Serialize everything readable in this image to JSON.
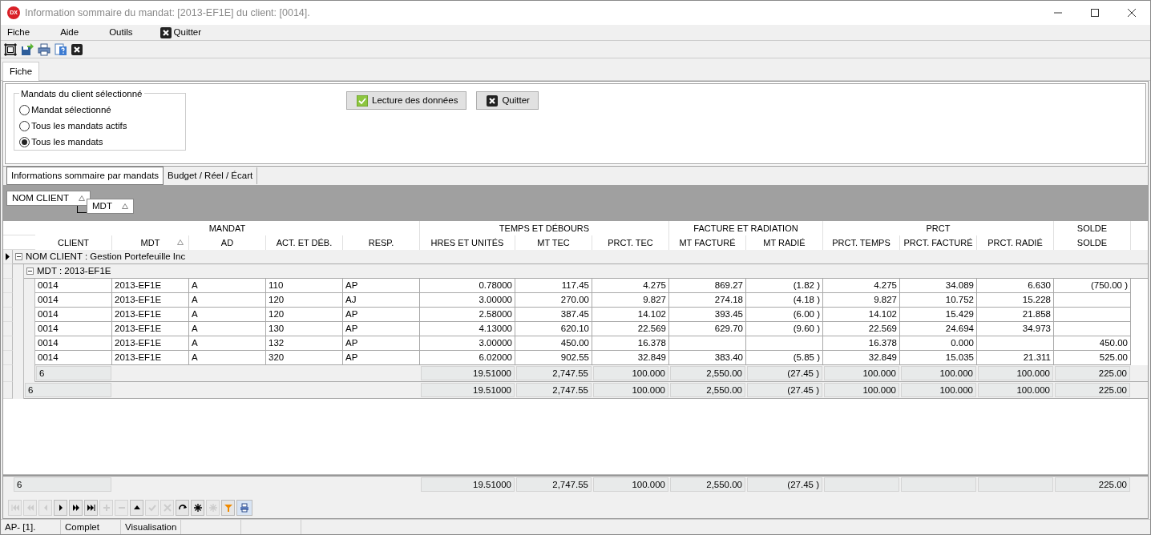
{
  "window": {
    "title": "Information sommaire du mandat: [2013-EF1E] du client: [0014].",
    "icon_text": "DX"
  },
  "menu": [
    {
      "label": "Fiche",
      "kind": "plain"
    },
    {
      "label": "Aide",
      "kind": "plain"
    },
    {
      "label": "Outils",
      "kind": "plain"
    },
    {
      "label": "Quitter",
      "kind": "close"
    }
  ],
  "toolbar": [
    {
      "kind": "frame"
    },
    {
      "kind": "save"
    },
    {
      "kind": "print"
    },
    {
      "kind": "help"
    },
    {
      "kind": "close"
    }
  ],
  "tabs": [
    {
      "label": "Fiche",
      "selected": true
    }
  ],
  "options": {
    "title": "Mandats du client sélectionné",
    "radios": [
      {
        "label": "Mandat sélectionné",
        "selected": false
      },
      {
        "label": "Tous les mandats actifs",
        "selected": false
      },
      {
        "label": "Tous les mandats",
        "selected": true
      }
    ]
  },
  "buttons": [
    {
      "label": "Lecture des données",
      "kind": "check"
    },
    {
      "label": "Quitter",
      "kind": "close"
    }
  ],
  "subtabs": [
    {
      "label": "Informations sommaire par mandats",
      "selected": true
    },
    {
      "label": "Budget / Réel / Écart",
      "selected": false
    }
  ],
  "group_by": [
    {
      "label": "NOM CLIENT"
    },
    {
      "label": "MDT"
    }
  ],
  "grid": {
    "bands": [
      {
        "label": "MANDAT",
        "columns": [
          {
            "label": "CLIENT",
            "sorted": false
          },
          {
            "label": "MDT",
            "sorted": true
          },
          {
            "label": "AD",
            "sorted": false
          },
          {
            "label": "ACT. ET DÉB.",
            "sorted": false
          },
          {
            "label": "RESP.",
            "sorted": false
          }
        ]
      },
      {
        "label": "TEMPS ET DÉBOURS",
        "columns": [
          {
            "label": "HRES ET UNITÉS",
            "sorted": false
          },
          {
            "label": "MT  TEC",
            "sorted": false
          },
          {
            "label": "PRCT.  TEC",
            "sorted": false
          }
        ]
      },
      {
        "label": "FACTURE ET RADIATION",
        "columns": [
          {
            "label": "MT FACTURÉ",
            "sorted": false
          },
          {
            "label": "MT RADIÉ",
            "sorted": false
          }
        ]
      },
      {
        "label": "PRCT",
        "columns": [
          {
            "label": "PRCT. TEMPS",
            "sorted": false
          },
          {
            "label": "PRCT.  FACTURÉ",
            "sorted": false
          },
          {
            "label": "PRCT. RADIÉ",
            "sorted": false
          }
        ]
      },
      {
        "label": "SOLDE",
        "columns": [
          {
            "label": "SOLDE",
            "sorted": false
          }
        ]
      }
    ],
    "group": {
      "label": "NOM CLIENT : Gestion Portefeuille Inc",
      "expanded": true,
      "current": true,
      "children": [
        {
          "label": "MDT : 2013-EF1E",
          "expanded": true,
          "current": false,
          "rows": [
            {
              "client": "0014",
              "mdt": "2013-EF1E",
              "ad": "A",
              "act": "110",
              "resp": "AP",
              "hres": "0.78000",
              "mt_tec": "117.45",
              "prct_tec": "4.275",
              "mt_facture": "869.27",
              "mt_radie": "(1.82 )",
              "prct_temps": "4.275",
              "prct_facture": "34.089",
              "prct_radie": "6.630",
              "solde": "(750.00 )"
            },
            {
              "client": "0014",
              "mdt": "2013-EF1E",
              "ad": "A",
              "act": "120",
              "resp": "AJ",
              "hres": "3.00000",
              "mt_tec": "270.00",
              "prct_tec": "9.827",
              "mt_facture": "274.18",
              "mt_radie": "(4.18 )",
              "prct_temps": "9.827",
              "prct_facture": "10.752",
              "prct_radie": "15.228"
            },
            {
              "client": "0014",
              "mdt": "2013-EF1E",
              "ad": "A",
              "act": "120",
              "resp": "AP",
              "hres": "2.58000",
              "mt_tec": "387.45",
              "prct_tec": "14.102",
              "mt_facture": "393.45",
              "mt_radie": "(6.00 )",
              "prct_temps": "14.102",
              "prct_facture": "15.429",
              "prct_radie": "21.858"
            },
            {
              "client": "0014",
              "mdt": "2013-EF1E",
              "ad": "A",
              "act": "130",
              "resp": "AP",
              "hres": "4.13000",
              "mt_tec": "620.10",
              "prct_tec": "22.569",
              "mt_facture": "629.70",
              "mt_radie": "(9.60 )",
              "prct_temps": "22.569",
              "prct_facture": "24.694",
              "prct_radie": "34.973"
            },
            {
              "client": "0014",
              "mdt": "2013-EF1E",
              "ad": "A",
              "act": "132",
              "resp": "AP",
              "hres": "3.00000",
              "mt_tec": "450.00",
              "prct_tec": "16.378",
              "prct_temps": "16.378",
              "prct_facture": "0.000",
              "solde": "450.00"
            },
            {
              "client": "0014",
              "mdt": "2013-EF1E",
              "ad": "A",
              "act": "320",
              "resp": "AP",
              "hres": "6.02000",
              "mt_tec": "902.55",
              "prct_tec": "32.849",
              "mt_facture": "383.40",
              "mt_radie": "(5.85 )",
              "prct_temps": "32.849",
              "prct_facture": "15.035",
              "prct_radie": "21.311",
              "solde": "525.00"
            }
          ],
          "footer": {
            "client": "6",
            "hres": "19.51000",
            "mt_tec": "2,747.55",
            "prct_tec": "100.000",
            "mt_facture": "2,550.00",
            "mt_radie": "(27.45 )",
            "prct_temps": "100.000",
            "prct_facture": "100.000",
            "prct_radie": "100.000",
            "solde": "225.00"
          }
        }
      ],
      "footer": {
        "client": "6",
        "hres": "19.51000",
        "mt_tec": "2,747.55",
        "prct_tec": "100.000",
        "mt_facture": "2,550.00",
        "mt_radie": "(27.45 )",
        "prct_temps": "100.000",
        "prct_facture": "100.000",
        "prct_radie": "100.000",
        "solde": "225.00"
      }
    },
    "totals": {
      "client": "6",
      "hres": "19.51000",
      "mt_tec": "2,747.55",
      "prct_tec": "100.000",
      "mt_facture": "2,550.00",
      "mt_radie": "(27.45 )",
      "solde": "225.00"
    }
  },
  "navigator": [
    {
      "kind": "first",
      "disabled": true
    },
    {
      "kind": "prev-page",
      "disabled": true
    },
    {
      "kind": "prev",
      "disabled": true
    },
    {
      "kind": "next",
      "disabled": false
    },
    {
      "kind": "next-page",
      "disabled": false
    },
    {
      "kind": "last",
      "disabled": false
    },
    {
      "kind": "insert",
      "disabled": true
    },
    {
      "kind": "delete",
      "disabled": true
    },
    {
      "kind": "edit",
      "disabled": false
    },
    {
      "kind": "post",
      "disabled": true
    },
    {
      "kind": "cancel",
      "disabled": true
    },
    {
      "kind": "refresh",
      "disabled": false
    },
    {
      "kind": "bookmark",
      "disabled": false
    },
    {
      "kind": "goto-bookmark",
      "disabled": true
    },
    {
      "kind": "filter",
      "disabled": false
    },
    {
      "kind": "print",
      "disabled": false
    }
  ],
  "status_bar": [
    "AP- [1].",
    "Complet",
    "Visualisation"
  ]
}
